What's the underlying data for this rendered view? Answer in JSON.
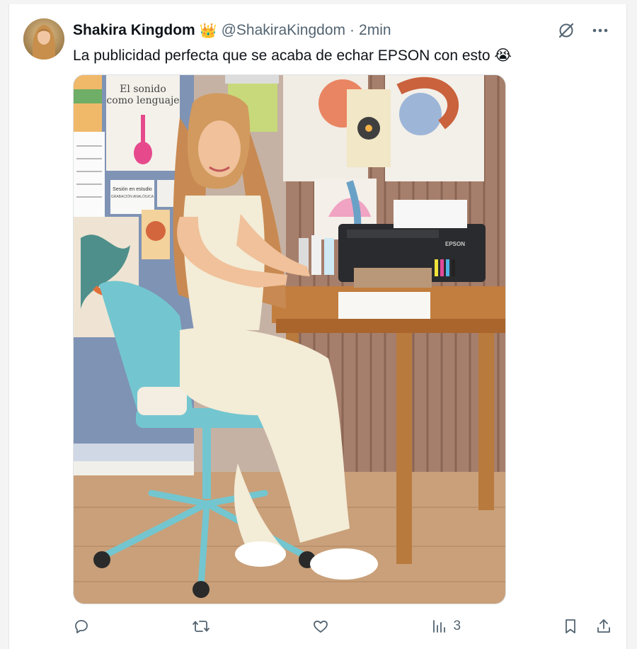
{
  "tweet": {
    "author_name": "Shakira Kingdom",
    "author_badge_icon": "crown-emoji",
    "handle": "@ShakiraKingdom",
    "separator": "·",
    "time": "2min",
    "text": "La publicidad perfecta que se acaba de echar EPSON con esto",
    "text_emoji": "😭"
  },
  "media": {
    "poster_title_line1": "El sonido",
    "poster_title_line2": "como lenguaje",
    "note_line1": "Sesión en estudio",
    "note_line2": "GRABACIÓN ANALÓGICA",
    "printer_brand": "EPSON"
  },
  "actions": {
    "reply_icon": "reply-icon",
    "retweet_icon": "retweet-icon",
    "like_icon": "heart-icon",
    "views_icon": "views-icon",
    "views_count": "3",
    "bookmark_icon": "bookmark-icon",
    "share_icon": "share-icon"
  },
  "colors": {
    "text_primary": "#0f1419",
    "text_secondary": "#536471",
    "border": "#dfe3e6"
  }
}
